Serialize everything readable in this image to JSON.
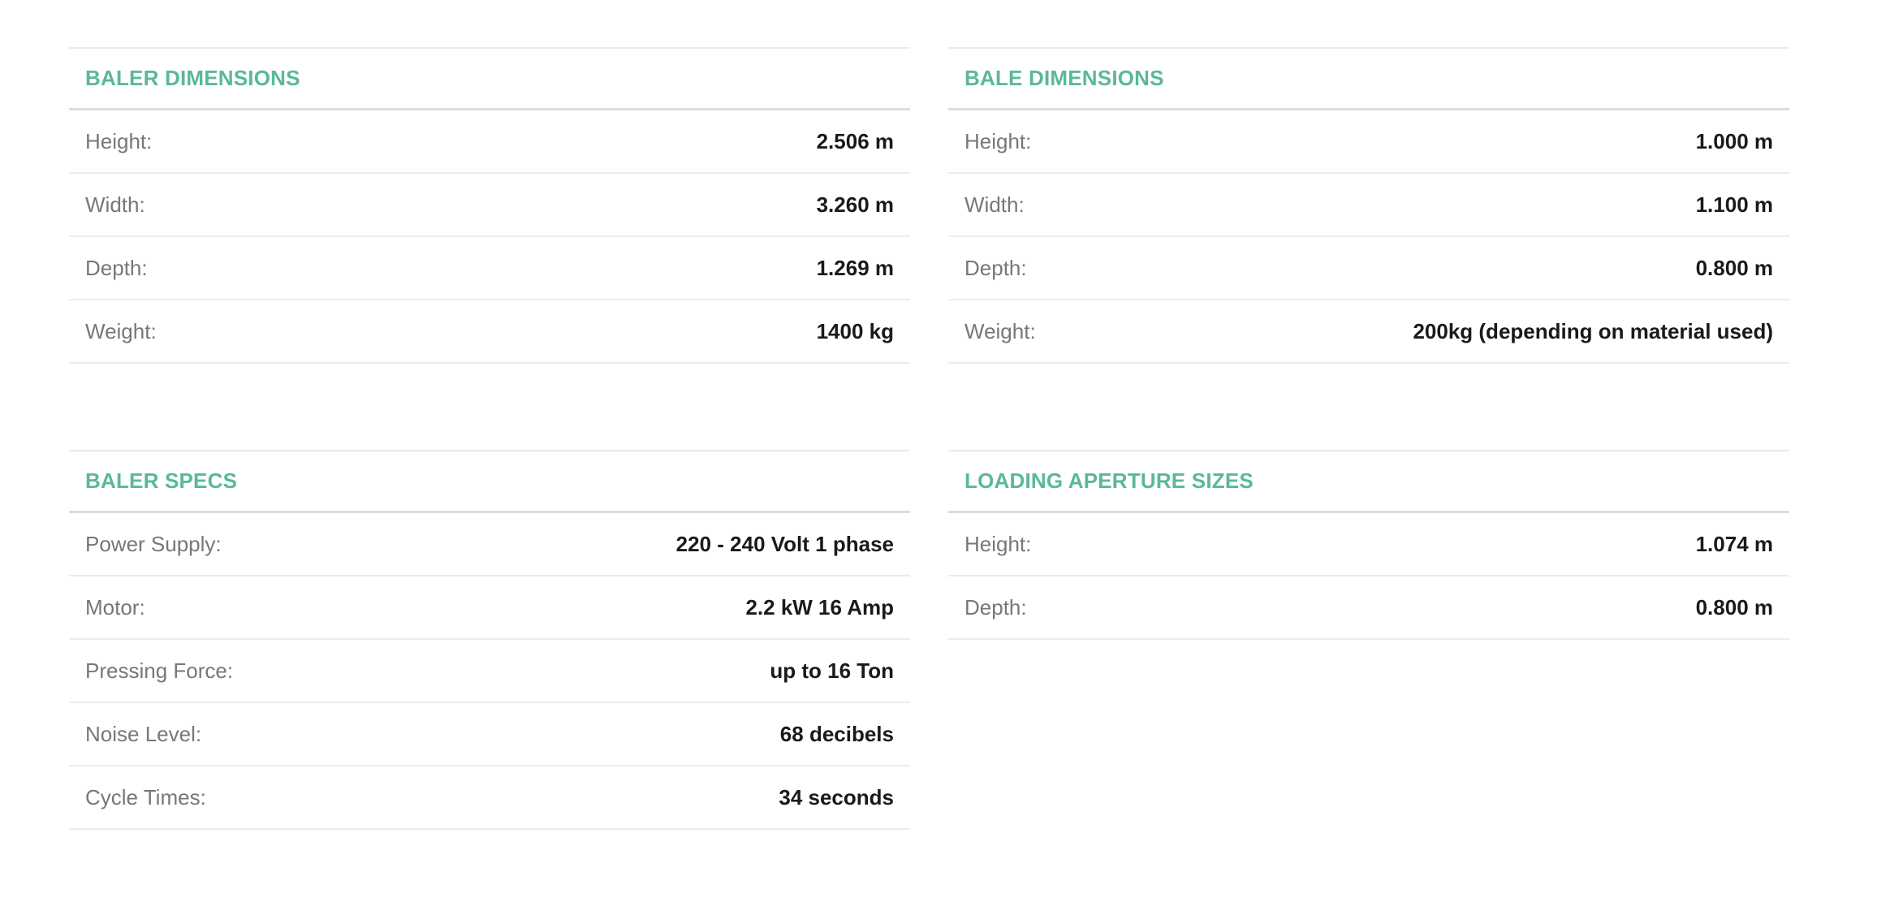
{
  "tables": [
    {
      "id": "baler-dimensions",
      "title": "BALER DIMENSIONS",
      "rows": [
        {
          "label": "Height:",
          "value": "2.506 m"
        },
        {
          "label": "Width:",
          "value": "3.260 m"
        },
        {
          "label": "Depth:",
          "value": "1.269 m"
        },
        {
          "label": "Weight:",
          "value": "1400 kg"
        }
      ]
    },
    {
      "id": "bale-dimensions",
      "title": "BALE DIMENSIONS",
      "rows": [
        {
          "label": "Height:",
          "value": "1.000 m"
        },
        {
          "label": "Width:",
          "value": "1.100 m"
        },
        {
          "label": "Depth:",
          "value": "0.800 m"
        },
        {
          "label": "Weight:",
          "value": "200kg (depending on material used)"
        }
      ]
    },
    {
      "id": "baler-specs",
      "title": "BALER SPECS",
      "rows": [
        {
          "label": "Power Supply:",
          "value": "220 - 240 Volt 1 phase"
        },
        {
          "label": "Motor:",
          "value": "2.2 kW 16 Amp"
        },
        {
          "label": "Pressing Force:",
          "value": "up to 16 Ton"
        },
        {
          "label": "Noise Level:",
          "value": "68 decibels"
        },
        {
          "label": "Cycle Times:",
          "value": "34 seconds"
        }
      ]
    },
    {
      "id": "loading-aperture-sizes",
      "title": "LOADING APERTURE SIZES",
      "rows": [
        {
          "label": "Height:",
          "value": "1.074 m"
        },
        {
          "label": "Depth:",
          "value": "0.800 m"
        }
      ]
    }
  ],
  "colors": {
    "title": "#5ab89a",
    "label": "#777777",
    "value": "#1a1a1a",
    "divider": "#ececec"
  }
}
